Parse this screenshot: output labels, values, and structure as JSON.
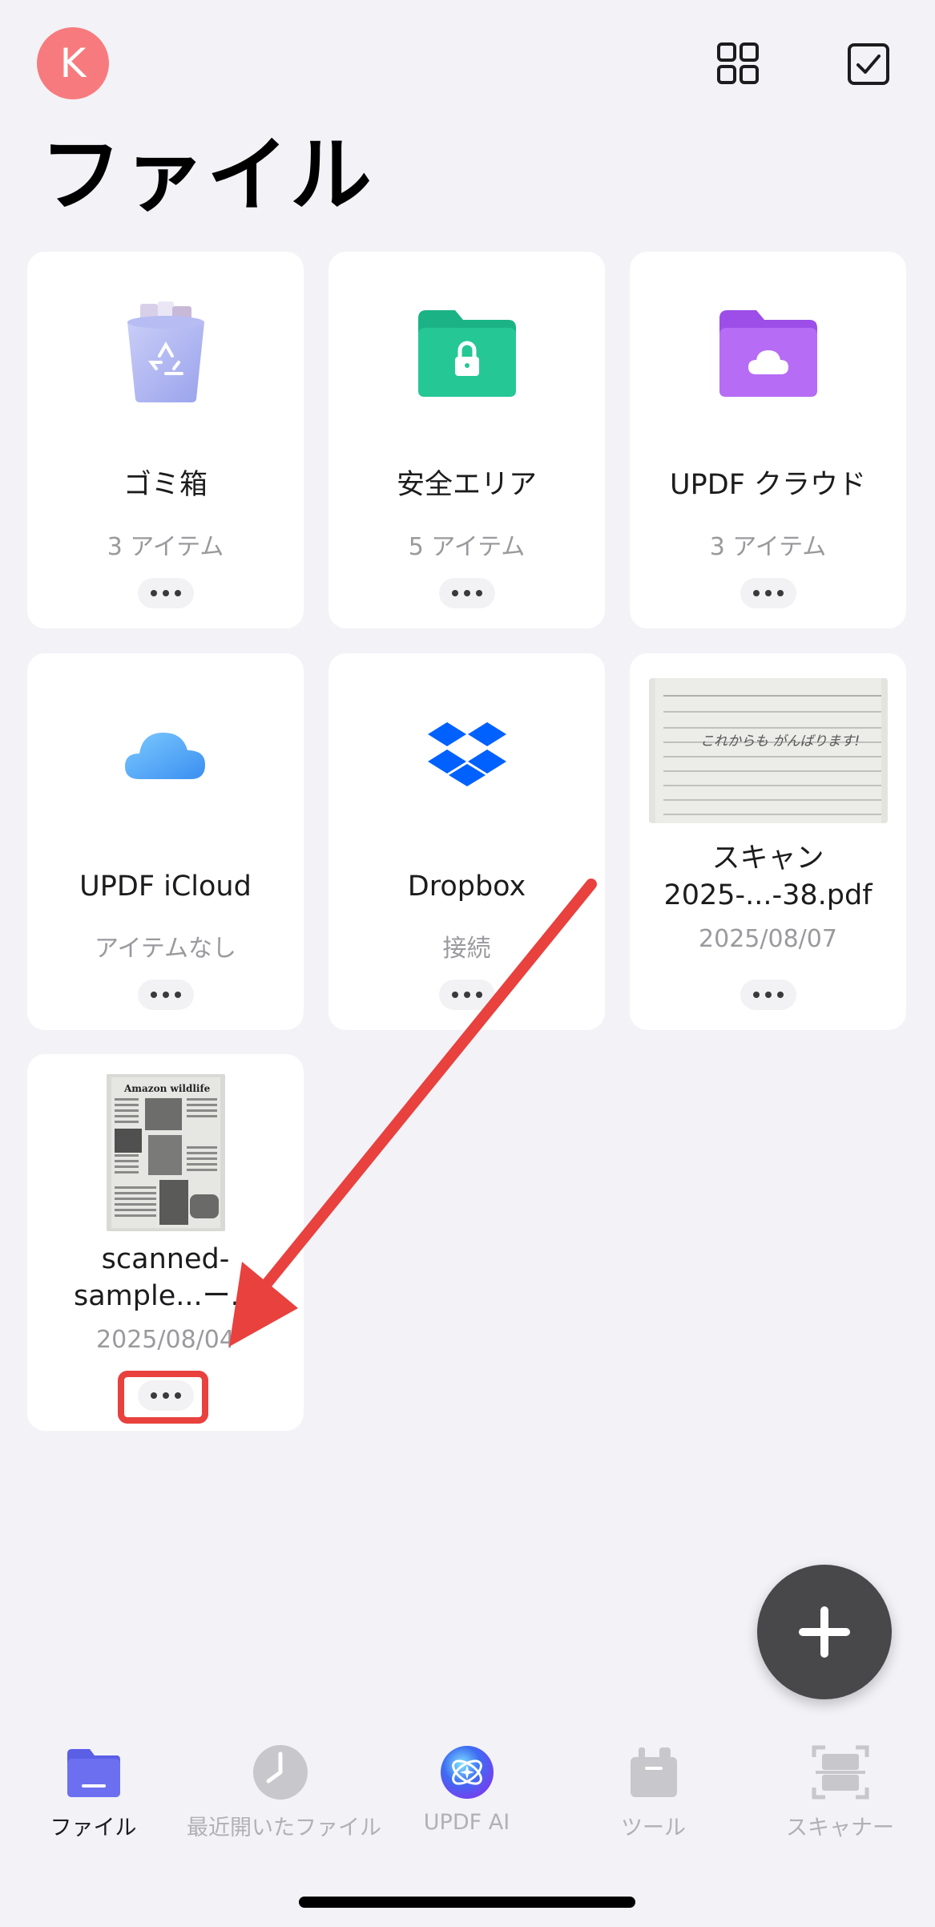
{
  "header": {
    "avatar_initial": "K",
    "page_title": "ファイル",
    "icons": [
      "grid-view-icon",
      "select-checkbox-icon"
    ]
  },
  "cards": [
    {
      "title": "ゴミ箱",
      "subtitle": "3 アイテム",
      "icon": "trash-icon"
    },
    {
      "title": "安全エリア",
      "subtitle": "5 アイテム",
      "icon": "secure-folder-icon"
    },
    {
      "title": "UPDF クラウド",
      "subtitle": "3 アイテム",
      "icon": "cloud-folder-icon"
    },
    {
      "title": "UPDF iCloud",
      "subtitle": "アイテムなし",
      "icon": "icloud-icon"
    },
    {
      "title": "Dropbox",
      "subtitle": "接続",
      "icon": "dropbox-icon"
    },
    {
      "title": "スキャン\n2025-...-38.pdf",
      "subtitle": "2025/08/07",
      "icon": "scan-thumbnail",
      "thumbnail_text": "これからも がんばります!"
    },
    {
      "title": "scanned-\nsample...ー.p",
      "subtitle": "2025/08/04",
      "icon": "pdf-thumbnail",
      "thumbnail_text": "Amazon wildlife"
    }
  ],
  "colors": {
    "background": "#f2f2f7",
    "avatar": "#f77b7e",
    "secure_green": "#1fbf8f",
    "cloud_purple": "#b05ef0",
    "dropbox_blue": "#0061fe",
    "annotation_red": "#e8413e",
    "fab": "#48484a"
  },
  "tabbar": {
    "tabs": [
      {
        "label": "ファイル",
        "icon": "files-folder-icon",
        "active": true
      },
      {
        "label": "最近開いたファイル",
        "icon": "clock-icon",
        "active": false
      },
      {
        "label": "UPDF AI",
        "icon": "ai-orb-icon",
        "active": false
      },
      {
        "label": "ツール",
        "icon": "toolbox-icon",
        "active": false
      },
      {
        "label": "スキャナー",
        "icon": "scanner-icon",
        "active": false
      }
    ]
  }
}
